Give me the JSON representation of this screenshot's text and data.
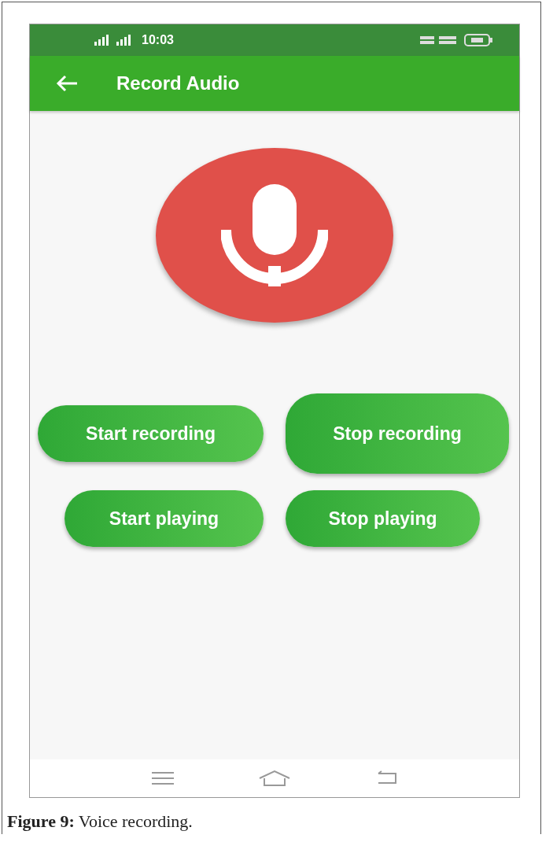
{
  "status_bar": {
    "time": "10:03"
  },
  "app_bar": {
    "title": "Record Audio"
  },
  "button_rows": [
    [
      "Start recording",
      "Stop recording"
    ],
    [
      "Start playing",
      "Stop playing"
    ]
  ],
  "caption": "**Figure 9:** Voice recording."
}
